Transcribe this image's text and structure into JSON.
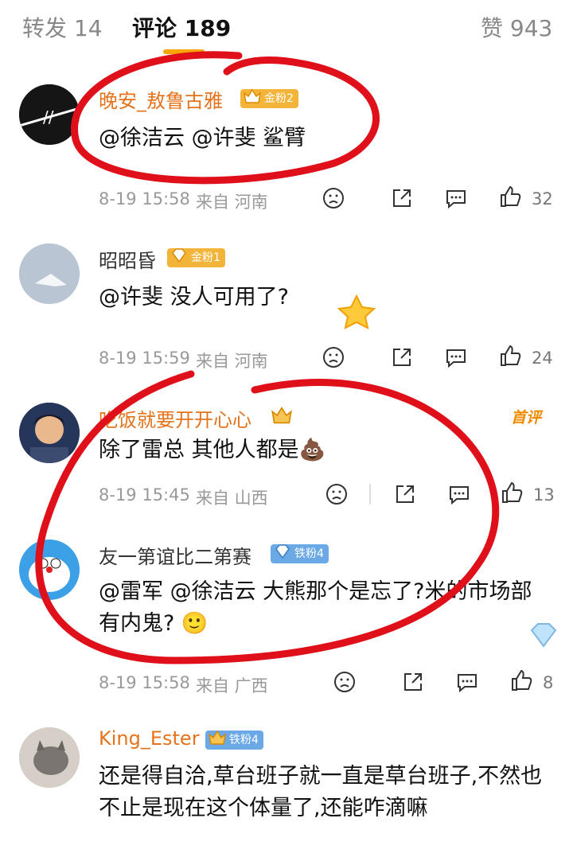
{
  "tabs": [
    {
      "label": "转发 14"
    },
    {
      "label": "评论 189"
    },
    {
      "label": "赞 943"
    }
  ],
  "comments": [
    {
      "username": "晚安_敖鲁古雅",
      "badge": "金粉2",
      "text": "@徐洁云 @许斐 鲨臂",
      "time": "8-19 15:58",
      "location": "来自 河南",
      "likes": "32"
    },
    {
      "username": "昭昭昏",
      "badge": "金粉1",
      "text": "@许斐 没人可用了?",
      "time": "8-19 15:59",
      "location": "来自 河南",
      "likes": "24"
    },
    {
      "username": "吃饭就要开开心心",
      "badge": "",
      "first_label": "首评",
      "text": "除了雷总 其他人都是💩",
      "time": "8-19 15:45",
      "location": "来自 山西",
      "likes": "13"
    },
    {
      "username": "友一第谊比二第赛",
      "badge": "铁粉4",
      "text": "@雷军 @徐洁云 大熊那个是忘了?米的市场部有内鬼? 🙂",
      "time": "8-19 15:58",
      "location": "来自 广西",
      "likes": "8"
    },
    {
      "username": "King_Ester",
      "badge": "铁粉4",
      "text": "还是得自洽,草台班子就一直是草台班子,不然也不止是现在这个体量了,还能咋滴嘛"
    }
  ],
  "colors": {
    "gold_badge": "#f3b43a",
    "iron_badge": "#6aa9e6",
    "username": "#e4731b",
    "annotation": "#e0101a"
  }
}
